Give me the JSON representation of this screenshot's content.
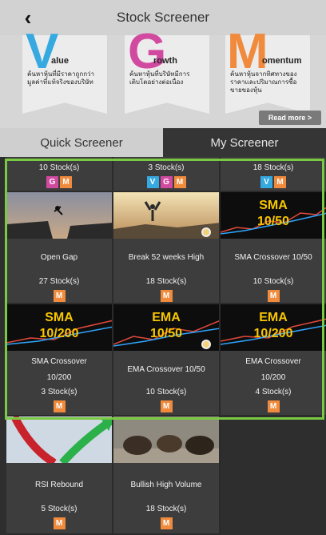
{
  "header": {
    "title": "Stock Screener",
    "back_icon": "chevron-left-icon"
  },
  "banner": {
    "cards": [
      {
        "letter": "V",
        "word": "alue",
        "desc": "ค้นหาหุ้นที่มีราคาถูกกว่ามูลค่าที่แท้จริงของบริษัท",
        "accent": "#35a9e0"
      },
      {
        "letter": "G",
        "word": "rowth",
        "desc": "ค้นหาหุ้นที่บริษัทมีการเติบโตอย่างต่อเนื่อง",
        "accent": "#d14aa0"
      },
      {
        "letter": "M",
        "word": "omentum",
        "desc": "ค้นหาหุ้นจากทิศทางของราคาและปริมาณการซื้อขายของหุ้น",
        "accent": "#f08a3c"
      }
    ],
    "read_more": "Read more >"
  },
  "tabs": {
    "quick": "Quick Screener",
    "my": "My Screener"
  },
  "colors": {
    "value_badge": "#35a9e0",
    "growth_badge": "#d14aa0",
    "momentum_badge": "#f08a3c",
    "highlight": "#7ac943"
  },
  "top_row": [
    {
      "count": "10 Stock(s)",
      "badges": [
        "G",
        "M"
      ]
    },
    {
      "count": "3 Stock(s)",
      "badges": [
        "V",
        "G",
        "M"
      ]
    },
    {
      "count": "18 Stock(s)",
      "badges": [
        "V",
        "M"
      ]
    }
  ],
  "screeners": [
    {
      "name": "Open Gap",
      "count": "27 Stock(s)",
      "badge": "M"
    },
    {
      "name": "Break 52 weeks High",
      "count": "18 Stock(s)",
      "badge": "M"
    },
    {
      "name": "SMA Crossover 10/50",
      "count": "10 Stock(s)",
      "badge": "M",
      "chart_label_1": "SMA",
      "chart_label_2": "10/50"
    },
    {
      "name_1": "SMA Crossover",
      "name_2": "10/200",
      "count": "3 Stock(s)",
      "badge": "M",
      "chart_label_1": "SMA",
      "chart_label_2": "10/200"
    },
    {
      "name": "EMA Crossover 10/50",
      "count": "10 Stock(s)",
      "badge": "M",
      "chart_label_1": "EMA",
      "chart_label_2": "10/50"
    },
    {
      "name_1": "EMA Crossover",
      "name_2": "10/200",
      "count": "4 Stock(s)",
      "badge": "M",
      "chart_label_1": "EMA",
      "chart_label_2": "10/200"
    },
    {
      "name": "RSI Rebound",
      "count": "5 Stock(s)",
      "badge": "M"
    },
    {
      "name": "Bullish High Volume",
      "count": "18 Stock(s)",
      "badge": "M"
    }
  ]
}
